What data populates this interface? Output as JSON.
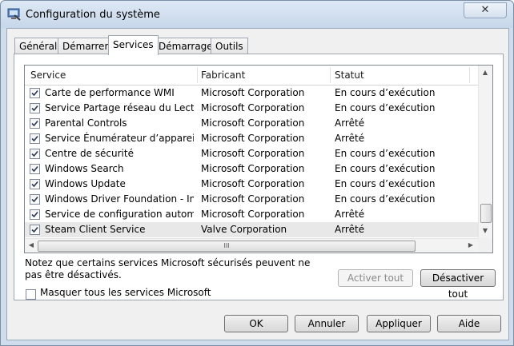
{
  "window": {
    "title": "Configuration du système",
    "close_glyph": "✕"
  },
  "tabs": [
    {
      "label": "Général"
    },
    {
      "label": "Démarrer"
    },
    {
      "label": "Services"
    },
    {
      "label": "Démarrage"
    },
    {
      "label": "Outils"
    }
  ],
  "active_tab": "Services",
  "columns": {
    "service": "Service",
    "manufacturer": "Fabricant",
    "status": "Statut"
  },
  "rows": [
    {
      "name": "Carte de performance WMI",
      "manufacturer": "Microsoft Corporation",
      "status": "En cours d’exécution",
      "checked": true
    },
    {
      "name": "Service Partage réseau du Lecte...",
      "manufacturer": "Microsoft Corporation",
      "status": "En cours d’exécution",
      "checked": true
    },
    {
      "name": "Parental Controls",
      "manufacturer": "Microsoft Corporation",
      "status": "Arrêté",
      "checked": true
    },
    {
      "name": "Service Énumérateur d’appareil ...",
      "manufacturer": "Microsoft Corporation",
      "status": "Arrêté",
      "checked": true
    },
    {
      "name": "Centre de sécurité",
      "manufacturer": "Microsoft Corporation",
      "status": "En cours d’exécution",
      "checked": true
    },
    {
      "name": "Windows Search",
      "manufacturer": "Microsoft Corporation",
      "status": "En cours d’exécution",
      "checked": true
    },
    {
      "name": "Windows Update",
      "manufacturer": "Microsoft Corporation",
      "status": "En cours d’exécution",
      "checked": true
    },
    {
      "name": "Windows Driver Foundation - Inf...",
      "manufacturer": "Microsoft Corporation",
      "status": "En cours d’exécution",
      "checked": true
    },
    {
      "name": "Service de configuration automa...",
      "manufacturer": "Microsoft Corporation",
      "status": "Arrêté",
      "checked": true
    },
    {
      "name": "Steam Client Service",
      "manufacturer": "Valve Corporation",
      "status": "Arrêté",
      "checked": true
    }
  ],
  "selected_row": "Steam Client Service",
  "note": "Notez que certains services Microsoft sécurisés peuvent ne pas être désactivés.",
  "buttons": {
    "enable_all": "Activer tout",
    "disable_all": "Désactiver tout",
    "ok": "OK",
    "cancel": "Annuler",
    "apply": "Appliquer",
    "help": "Aide"
  },
  "hide_ms_label": "Masquer tous les services Microsoft",
  "hide_ms_checked": false,
  "scrollbar": {
    "hthumb_grip": "III",
    "up_glyph": "▲",
    "down_glyph": "▼",
    "left_glyph": "◀",
    "right_glyph": "▶"
  }
}
